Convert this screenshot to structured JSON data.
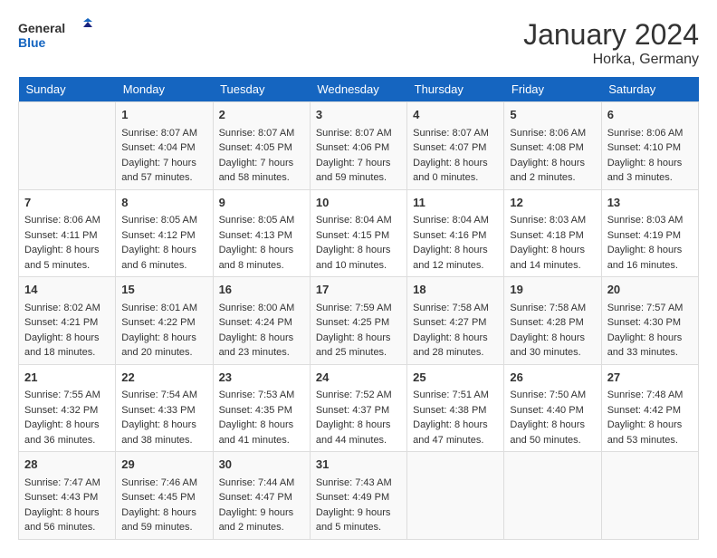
{
  "header": {
    "logo_line1": "General",
    "logo_line2": "Blue",
    "title": "January 2024",
    "subtitle": "Horka, Germany"
  },
  "days_of_week": [
    "Sunday",
    "Monday",
    "Tuesday",
    "Wednesday",
    "Thursday",
    "Friday",
    "Saturday"
  ],
  "weeks": [
    [
      {
        "day": "",
        "sunrise": "",
        "sunset": "",
        "daylight": ""
      },
      {
        "day": "1",
        "sunrise": "Sunrise: 8:07 AM",
        "sunset": "Sunset: 4:04 PM",
        "daylight": "Daylight: 7 hours and 57 minutes."
      },
      {
        "day": "2",
        "sunrise": "Sunrise: 8:07 AM",
        "sunset": "Sunset: 4:05 PM",
        "daylight": "Daylight: 7 hours and 58 minutes."
      },
      {
        "day": "3",
        "sunrise": "Sunrise: 8:07 AM",
        "sunset": "Sunset: 4:06 PM",
        "daylight": "Daylight: 7 hours and 59 minutes."
      },
      {
        "day": "4",
        "sunrise": "Sunrise: 8:07 AM",
        "sunset": "Sunset: 4:07 PM",
        "daylight": "Daylight: 8 hours and 0 minutes."
      },
      {
        "day": "5",
        "sunrise": "Sunrise: 8:06 AM",
        "sunset": "Sunset: 4:08 PM",
        "daylight": "Daylight: 8 hours and 2 minutes."
      },
      {
        "day": "6",
        "sunrise": "Sunrise: 8:06 AM",
        "sunset": "Sunset: 4:10 PM",
        "daylight": "Daylight: 8 hours and 3 minutes."
      }
    ],
    [
      {
        "day": "7",
        "sunrise": "Sunrise: 8:06 AM",
        "sunset": "Sunset: 4:11 PM",
        "daylight": "Daylight: 8 hours and 5 minutes."
      },
      {
        "day": "8",
        "sunrise": "Sunrise: 8:05 AM",
        "sunset": "Sunset: 4:12 PM",
        "daylight": "Daylight: 8 hours and 6 minutes."
      },
      {
        "day": "9",
        "sunrise": "Sunrise: 8:05 AM",
        "sunset": "Sunset: 4:13 PM",
        "daylight": "Daylight: 8 hours and 8 minutes."
      },
      {
        "day": "10",
        "sunrise": "Sunrise: 8:04 AM",
        "sunset": "Sunset: 4:15 PM",
        "daylight": "Daylight: 8 hours and 10 minutes."
      },
      {
        "day": "11",
        "sunrise": "Sunrise: 8:04 AM",
        "sunset": "Sunset: 4:16 PM",
        "daylight": "Daylight: 8 hours and 12 minutes."
      },
      {
        "day": "12",
        "sunrise": "Sunrise: 8:03 AM",
        "sunset": "Sunset: 4:18 PM",
        "daylight": "Daylight: 8 hours and 14 minutes."
      },
      {
        "day": "13",
        "sunrise": "Sunrise: 8:03 AM",
        "sunset": "Sunset: 4:19 PM",
        "daylight": "Daylight: 8 hours and 16 minutes."
      }
    ],
    [
      {
        "day": "14",
        "sunrise": "Sunrise: 8:02 AM",
        "sunset": "Sunset: 4:21 PM",
        "daylight": "Daylight: 8 hours and 18 minutes."
      },
      {
        "day": "15",
        "sunrise": "Sunrise: 8:01 AM",
        "sunset": "Sunset: 4:22 PM",
        "daylight": "Daylight: 8 hours and 20 minutes."
      },
      {
        "day": "16",
        "sunrise": "Sunrise: 8:00 AM",
        "sunset": "Sunset: 4:24 PM",
        "daylight": "Daylight: 8 hours and 23 minutes."
      },
      {
        "day": "17",
        "sunrise": "Sunrise: 7:59 AM",
        "sunset": "Sunset: 4:25 PM",
        "daylight": "Daylight: 8 hours and 25 minutes."
      },
      {
        "day": "18",
        "sunrise": "Sunrise: 7:58 AM",
        "sunset": "Sunset: 4:27 PM",
        "daylight": "Daylight: 8 hours and 28 minutes."
      },
      {
        "day": "19",
        "sunrise": "Sunrise: 7:58 AM",
        "sunset": "Sunset: 4:28 PM",
        "daylight": "Daylight: 8 hours and 30 minutes."
      },
      {
        "day": "20",
        "sunrise": "Sunrise: 7:57 AM",
        "sunset": "Sunset: 4:30 PM",
        "daylight": "Daylight: 8 hours and 33 minutes."
      }
    ],
    [
      {
        "day": "21",
        "sunrise": "Sunrise: 7:55 AM",
        "sunset": "Sunset: 4:32 PM",
        "daylight": "Daylight: 8 hours and 36 minutes."
      },
      {
        "day": "22",
        "sunrise": "Sunrise: 7:54 AM",
        "sunset": "Sunset: 4:33 PM",
        "daylight": "Daylight: 8 hours and 38 minutes."
      },
      {
        "day": "23",
        "sunrise": "Sunrise: 7:53 AM",
        "sunset": "Sunset: 4:35 PM",
        "daylight": "Daylight: 8 hours and 41 minutes."
      },
      {
        "day": "24",
        "sunrise": "Sunrise: 7:52 AM",
        "sunset": "Sunset: 4:37 PM",
        "daylight": "Daylight: 8 hours and 44 minutes."
      },
      {
        "day": "25",
        "sunrise": "Sunrise: 7:51 AM",
        "sunset": "Sunset: 4:38 PM",
        "daylight": "Daylight: 8 hours and 47 minutes."
      },
      {
        "day": "26",
        "sunrise": "Sunrise: 7:50 AM",
        "sunset": "Sunset: 4:40 PM",
        "daylight": "Daylight: 8 hours and 50 minutes."
      },
      {
        "day": "27",
        "sunrise": "Sunrise: 7:48 AM",
        "sunset": "Sunset: 4:42 PM",
        "daylight": "Daylight: 8 hours and 53 minutes."
      }
    ],
    [
      {
        "day": "28",
        "sunrise": "Sunrise: 7:47 AM",
        "sunset": "Sunset: 4:43 PM",
        "daylight": "Daylight: 8 hours and 56 minutes."
      },
      {
        "day": "29",
        "sunrise": "Sunrise: 7:46 AM",
        "sunset": "Sunset: 4:45 PM",
        "daylight": "Daylight: 8 hours and 59 minutes."
      },
      {
        "day": "30",
        "sunrise": "Sunrise: 7:44 AM",
        "sunset": "Sunset: 4:47 PM",
        "daylight": "Daylight: 9 hours and 2 minutes."
      },
      {
        "day": "31",
        "sunrise": "Sunrise: 7:43 AM",
        "sunset": "Sunset: 4:49 PM",
        "daylight": "Daylight: 9 hours and 5 minutes."
      },
      {
        "day": "",
        "sunrise": "",
        "sunset": "",
        "daylight": ""
      },
      {
        "day": "",
        "sunrise": "",
        "sunset": "",
        "daylight": ""
      },
      {
        "day": "",
        "sunrise": "",
        "sunset": "",
        "daylight": ""
      }
    ]
  ]
}
